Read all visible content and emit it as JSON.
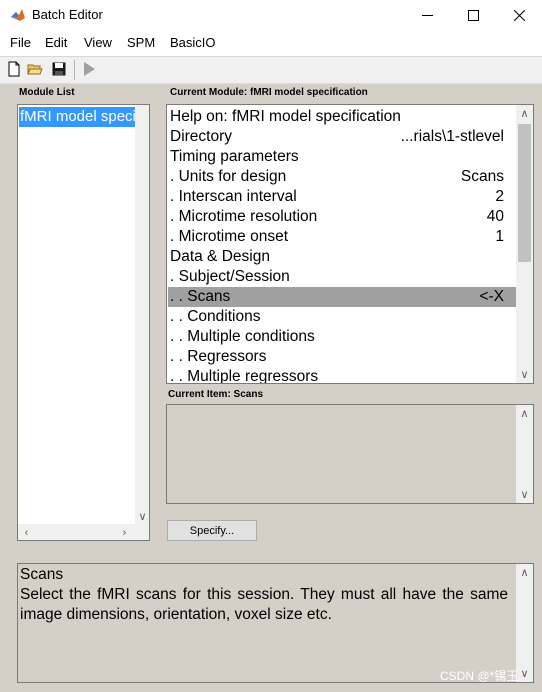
{
  "window": {
    "title": "Batch Editor",
    "icon": "matlab-icon",
    "controls": [
      "minimize-icon",
      "maximize-icon",
      "close-icon"
    ]
  },
  "menu": [
    "File",
    "Edit",
    "View",
    "SPM",
    "BasicIO"
  ],
  "toolbar": {
    "icons": [
      "new-file-icon",
      "open-folder-icon",
      "save-icon",
      "run-icon"
    ]
  },
  "module_list": {
    "label": "Module List",
    "items": [
      "fMRI model specification"
    ],
    "selected": 0
  },
  "current_module": {
    "label": "Current Module: fMRI model specification",
    "rows": [
      {
        "label": "Help on: fMRI model specification",
        "value": ""
      },
      {
        "label": "Directory",
        "value": "...rials\\1-stlevel"
      },
      {
        "label": "Timing parameters",
        "value": ""
      },
      {
        "label": ". Units for design",
        "value": "Scans"
      },
      {
        "label": ". Interscan interval",
        "value": "2"
      },
      {
        "label": ". Microtime resolution",
        "value": "40"
      },
      {
        "label": ". Microtime onset",
        "value": "1"
      },
      {
        "label": "Data & Design",
        "value": ""
      },
      {
        "label": ". Subject/Session",
        "value": ""
      },
      {
        "label": ". . Scans",
        "value": "<-X",
        "selected": true
      },
      {
        "label": ". . Conditions",
        "value": ""
      },
      {
        "label": ". . Multiple conditions",
        "value": ""
      },
      {
        "label": ". . Regressors",
        "value": ""
      },
      {
        "label": ". . Multiple regressors",
        "value": ""
      }
    ]
  },
  "current_item": {
    "label": "Current Item: Scans"
  },
  "specify_button": "Specify...",
  "help": {
    "title": "Scans",
    "text": "Select the fMRI scans for this session. They must all have the same image dimensions, orientation, voxel size etc."
  },
  "watermark": "CSDN @*锡玉",
  "colors": {
    "selection": "#3399ff",
    "row_highlight": "#a0a0a0",
    "figure_bg": "#d4d0c8"
  }
}
